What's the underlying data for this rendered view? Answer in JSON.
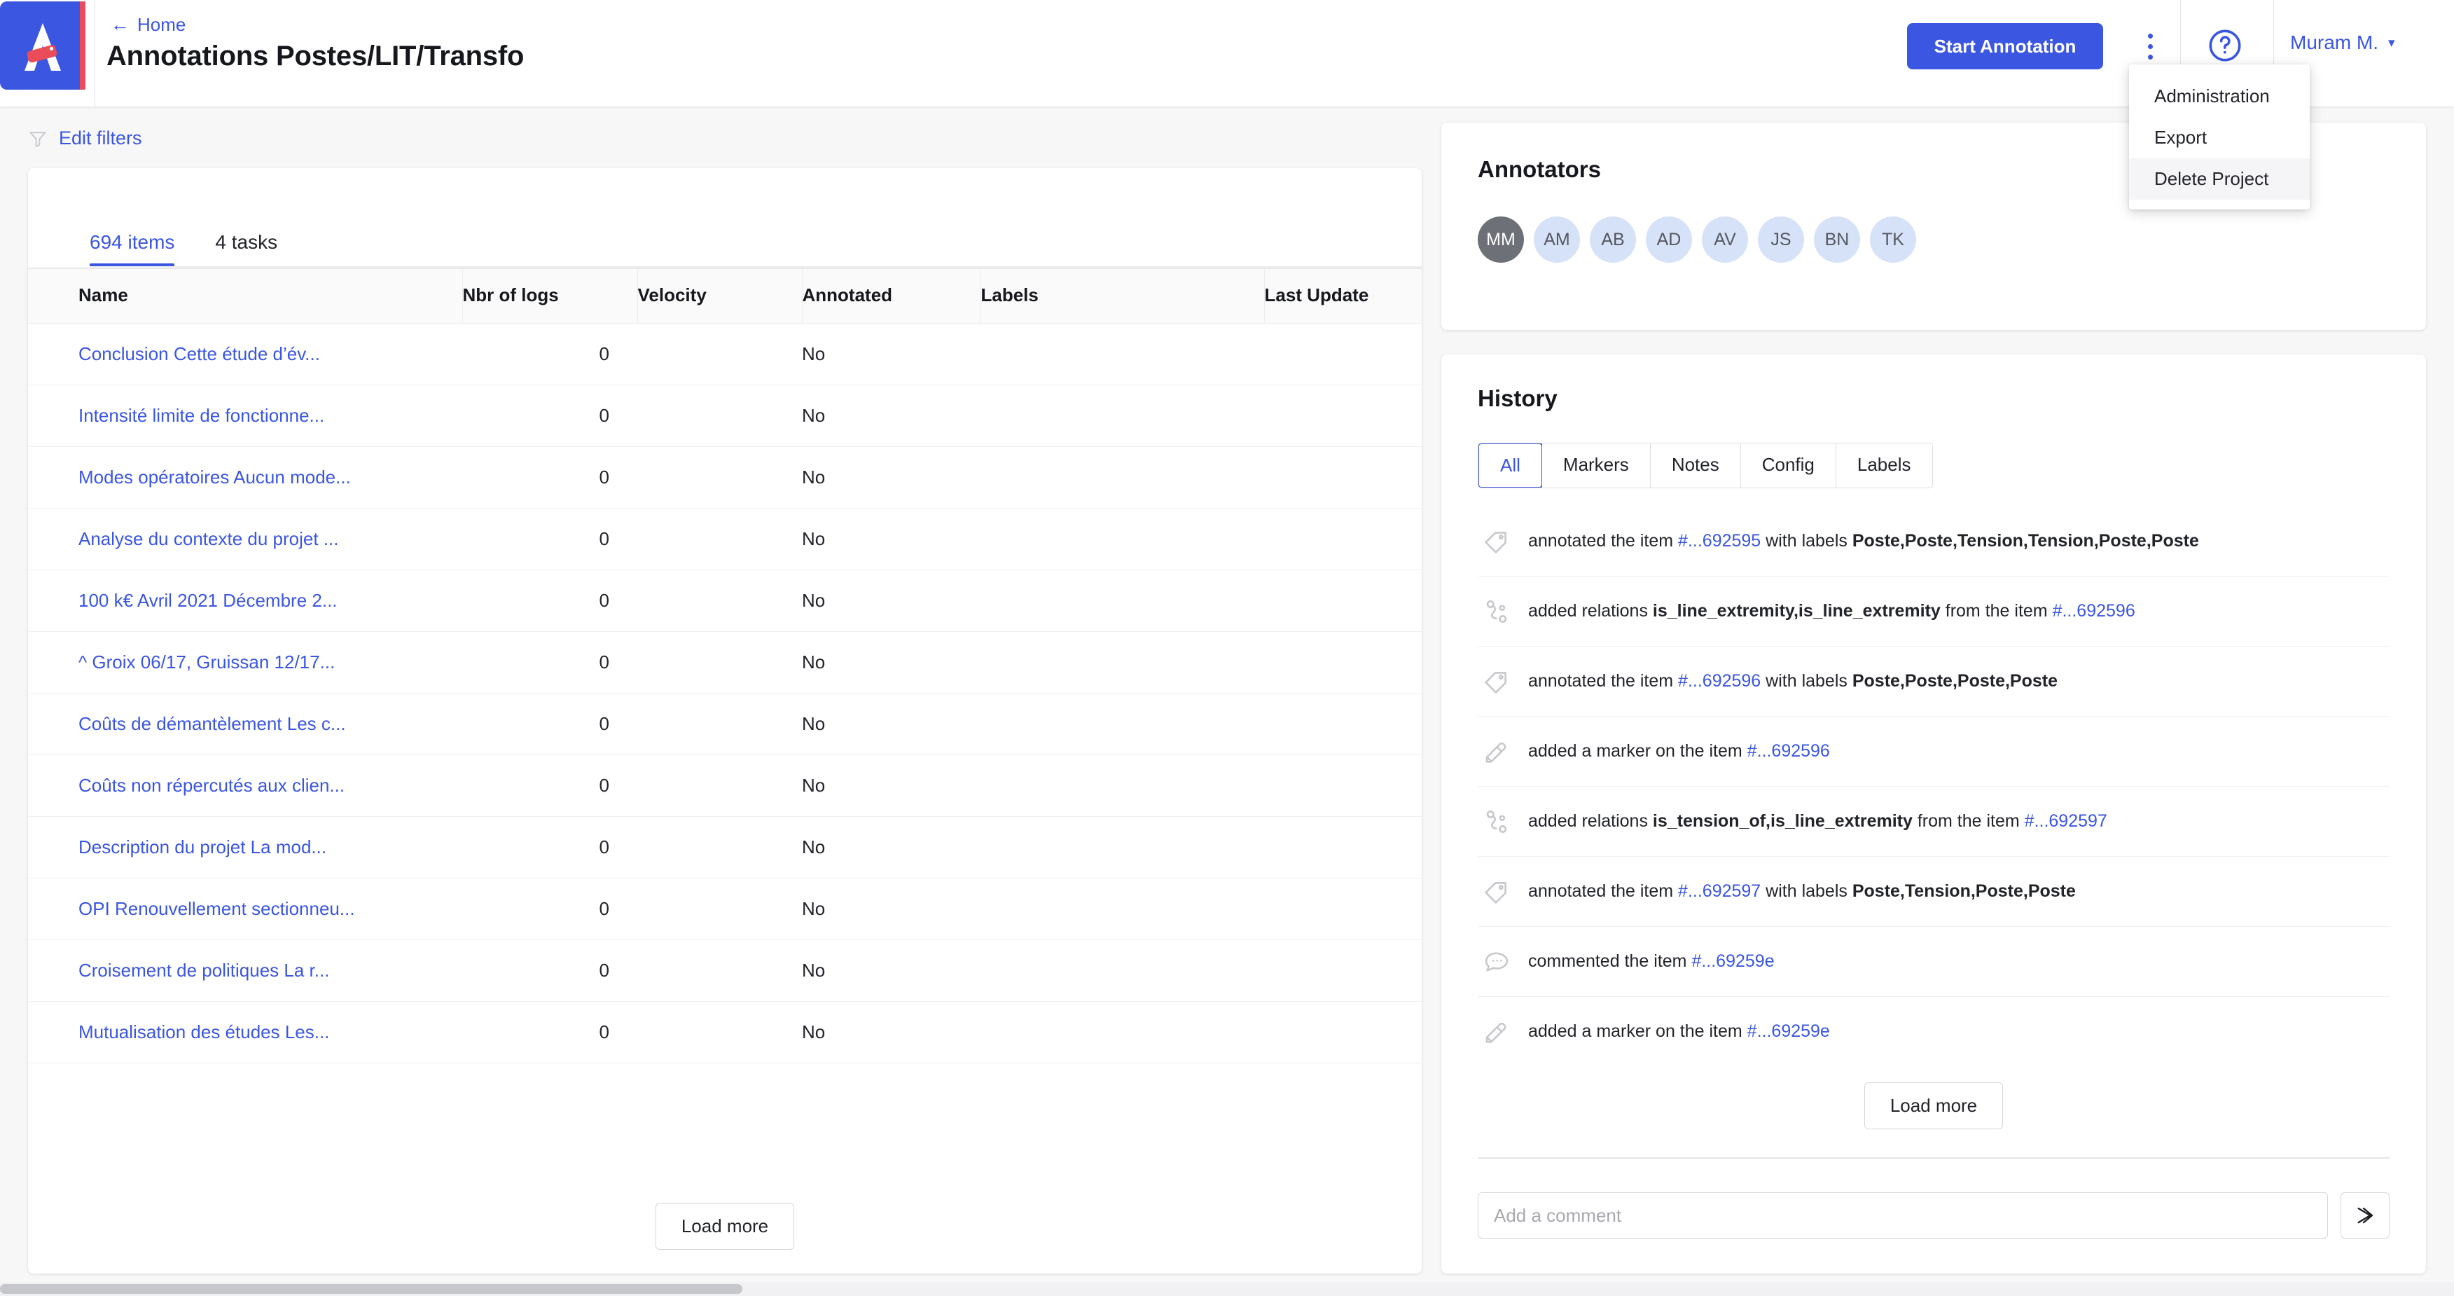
{
  "header": {
    "logo_letter": "A",
    "home_label": "Home",
    "back_icon": "arrow-left-icon",
    "title": "Annotations Postes/LIT/Transfo",
    "start_annotation_label": "Start Annotation",
    "kebab_icon": "more-vertical-icon",
    "help_icon": "help-circle-icon",
    "user_name": "Muram M.",
    "user_caret_icon": "chevron-down-icon"
  },
  "dropdown": {
    "items": [
      {
        "label": "Administration",
        "hover": false
      },
      {
        "label": "Export",
        "hover": false
      },
      {
        "label": "Delete Project",
        "hover": true
      }
    ]
  },
  "filterbar": {
    "icon": "filter-funnel-icon",
    "label": "Edit filters"
  },
  "items_panel": {
    "tabs": [
      {
        "label": "694 items",
        "active": true
      },
      {
        "label": "4 tasks",
        "active": false
      }
    ],
    "columns": [
      "Name",
      "Nbr of logs",
      "Velocity",
      "Annotated",
      "Labels",
      "Last Update"
    ],
    "rows": [
      {
        "name": "Conclusion Cette étude d’év...",
        "logs": "0",
        "velocity": "",
        "annotated": "No",
        "labels": "",
        "last_update": ""
      },
      {
        "name": "Intensité limite de fonctionne...",
        "logs": "0",
        "velocity": "",
        "annotated": "No",
        "labels": "",
        "last_update": ""
      },
      {
        "name": "Modes opératoires Aucun mode...",
        "logs": "0",
        "velocity": "",
        "annotated": "No",
        "labels": "",
        "last_update": ""
      },
      {
        "name": "Analyse du contexte du projet ...",
        "logs": "0",
        "velocity": "",
        "annotated": "No",
        "labels": "",
        "last_update": ""
      },
      {
        "name": "100 k€ Avril 2021 Décembre 2...",
        "logs": "0",
        "velocity": "",
        "annotated": "No",
        "labels": "",
        "last_update": ""
      },
      {
        "name": "^ Groix 06/17, Gruissan 12/17...",
        "logs": "0",
        "velocity": "",
        "annotated": "No",
        "labels": "",
        "last_update": ""
      },
      {
        "name": "Coûts de démantèlement Les c...",
        "logs": "0",
        "velocity": "",
        "annotated": "No",
        "labels": "",
        "last_update": ""
      },
      {
        "name": "Coûts non répercutés aux clien...",
        "logs": "0",
        "velocity": "",
        "annotated": "No",
        "labels": "",
        "last_update": ""
      },
      {
        "name": "Description du projet La mod...",
        "logs": "0",
        "velocity": "",
        "annotated": "No",
        "labels": "",
        "last_update": ""
      },
      {
        "name": "OPI Renouvellement sectionneu...",
        "logs": "0",
        "velocity": "",
        "annotated": "No",
        "labels": "",
        "last_update": ""
      },
      {
        "name": "Croisement de politiques La r...",
        "logs": "0",
        "velocity": "",
        "annotated": "No",
        "labels": "",
        "last_update": ""
      },
      {
        "name": "Mutualisation des études Les...",
        "logs": "0",
        "velocity": "",
        "annotated": "No",
        "labels": "",
        "last_update": ""
      }
    ],
    "load_more_label": "Load more"
  },
  "annotators": {
    "title": "Annotators",
    "avatars": [
      {
        "initials": "MM",
        "self": true
      },
      {
        "initials": "AM",
        "self": false
      },
      {
        "initials": "AB",
        "self": false
      },
      {
        "initials": "AD",
        "self": false
      },
      {
        "initials": "AV",
        "self": false
      },
      {
        "initials": "JS",
        "self": false
      },
      {
        "initials": "BN",
        "self": false
      },
      {
        "initials": "TK",
        "self": false
      }
    ]
  },
  "history": {
    "title": "History",
    "filters": [
      {
        "label": "All",
        "active": true
      },
      {
        "label": "Markers",
        "active": false
      },
      {
        "label": "Notes",
        "active": false
      },
      {
        "label": "Config",
        "active": false
      },
      {
        "label": "Labels",
        "active": false
      }
    ],
    "entries": [
      {
        "icon": "tag-icon",
        "pre": "annotated the item ",
        "ref": "#...692595",
        "mid": " with labels ",
        "bold": "Poste,Poste,Tension,Tension,Poste,Poste",
        "post": ""
      },
      {
        "icon": "relation-icon",
        "pre": "added relations ",
        "ref": "#...692596",
        "mid": "",
        "bold": "is_line_extremity,is_line_extremity",
        "post": " from the item ",
        "bold_first": true
      },
      {
        "icon": "tag-icon",
        "pre": "annotated the item ",
        "ref": "#...692596",
        "mid": " with labels ",
        "bold": "Poste,Poste,Poste,Poste",
        "post": ""
      },
      {
        "icon": "marker-icon",
        "pre": "added a marker on the item ",
        "ref": "#...692596",
        "mid": "",
        "bold": "",
        "post": ""
      },
      {
        "icon": "relation-icon",
        "pre": "added relations ",
        "ref": "#...692597",
        "mid": "",
        "bold": "is_tension_of,is_line_extremity",
        "post": " from the item ",
        "bold_first": true
      },
      {
        "icon": "tag-icon",
        "pre": "annotated the item ",
        "ref": "#...692597",
        "mid": " with labels ",
        "bold": "Poste,Tension,Poste,Poste",
        "post": ""
      },
      {
        "icon": "comment-icon",
        "pre": "commented the item ",
        "ref": "#...69259e",
        "mid": "",
        "bold": "",
        "post": ""
      },
      {
        "icon": "marker-icon",
        "pre": "added a marker on the item ",
        "ref": "#...69259e",
        "mid": "",
        "bold": "",
        "post": ""
      }
    ],
    "load_more_label": "Load more",
    "comment_placeholder": "Add a comment",
    "send_icon": "send-arrow-icon"
  },
  "colors": {
    "accent": "#3b56e0",
    "logo_red": "#ea4c5a",
    "page_bg": "#f7f7f8",
    "card_bg": "#ffffff",
    "avatar_bg": "#d6e2f8",
    "avatar_self_bg": "#6d7076"
  }
}
